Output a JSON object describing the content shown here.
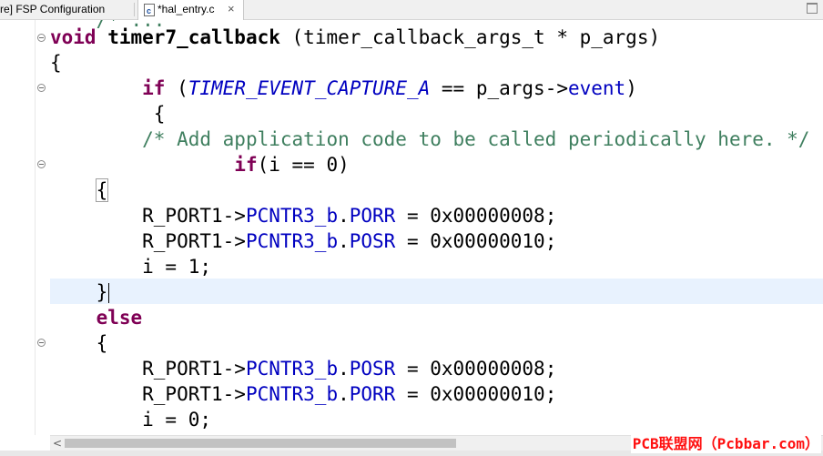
{
  "tabs": {
    "inactive_label": "re] FSP Configuration",
    "active_label": "*hal_entry.c",
    "close_glyph": "×"
  },
  "editor": {
    "partial_top": "    /* ...                                      ",
    "lines": {
      "l1_kw": "void",
      "l1_fn": "timer7_callback",
      "l1_rest": " (timer_callback_args_t * p_args)",
      "l2": "{",
      "l3_indent": "        ",
      "l3_kw": "if",
      "l3_a": " (",
      "l3_enum": "TIMER_EVENT_CAPTURE_A",
      "l3_b": " == p_args->",
      "l3_fld": "event",
      "l3_c": ")",
      "l4": "         {",
      "l5_indent": "        ",
      "l5_cmt": "/* Add application code to be called periodically here. */",
      "l6_indent": "                ",
      "l6_kw": "if",
      "l6_rest": "(i == 0)",
      "l7_indent": "    ",
      "l7": "{",
      "l8_a": "        R_PORT1->",
      "l8_fld1": "PCNTR3_b",
      "l8_dot": ".",
      "l8_fld2": "PORR",
      "l8_b": " = 0x00000008;",
      "l9_a": "        R_PORT1->",
      "l9_fld1": "PCNTR3_b",
      "l9_dot": ".",
      "l9_fld2": "POSR",
      "l9_b": " = 0x00000010;",
      "l10": "        i = 1;",
      "l11": "    }",
      "l12_indent": "    ",
      "l12_kw": "else",
      "l13": "    {",
      "l14_a": "        R_PORT1->",
      "l14_fld1": "PCNTR3_b",
      "l14_dot": ".",
      "l14_fld2": "POSR",
      "l14_b": " = 0x00000008;",
      "l15_a": "        R_PORT1->",
      "l15_fld1": "PCNTR3_b",
      "l15_dot": ".",
      "l15_fld2": "PORR",
      "l15_b": " = 0x00000010;",
      "l16": "        i = 0;"
    }
  },
  "scrollbar": {
    "left_arrow": "<"
  },
  "watermark": "PCB联盟网（Pcbbar.com）",
  "colors": {
    "keyword": "#7f0055",
    "field": "#0000c0",
    "comment": "#3f7f5f",
    "current_line": "#e8f2fe",
    "watermark": "#ff1010"
  }
}
